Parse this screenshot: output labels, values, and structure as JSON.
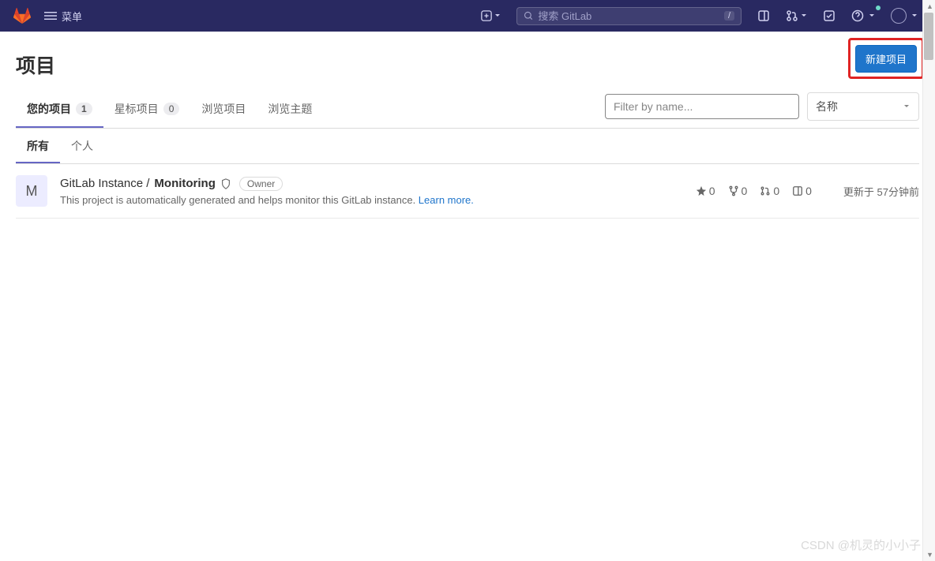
{
  "navbar": {
    "menu_label": "菜单",
    "search_placeholder": "搜索 GitLab",
    "search_shortcut": "/"
  },
  "page": {
    "title": "项目",
    "new_project_button": "新建项目"
  },
  "tabs": {
    "your_projects": {
      "label": "您的项目",
      "count": "1"
    },
    "starred_projects": {
      "label": "星标项目",
      "count": "0"
    },
    "explore_projects": {
      "label": "浏览项目"
    },
    "explore_topics": {
      "label": "浏览主题"
    }
  },
  "filter": {
    "placeholder": "Filter by name...",
    "sort_label": "名称"
  },
  "sub_tabs": {
    "all": "所有",
    "personal": "个人"
  },
  "project": {
    "avatar_letter": "M",
    "namespace": "GitLab Instance / ",
    "name": "Monitoring",
    "role_badge": "Owner",
    "description_text": "This project is automatically generated and helps monitor this GitLab instance. ",
    "learn_more": "Learn more.",
    "stats": {
      "stars": "0",
      "forks": "0",
      "merge_requests": "0",
      "issues": "0"
    },
    "updated_at": "更新于 57分钟前"
  },
  "watermark": "CSDN @机灵的小小子"
}
